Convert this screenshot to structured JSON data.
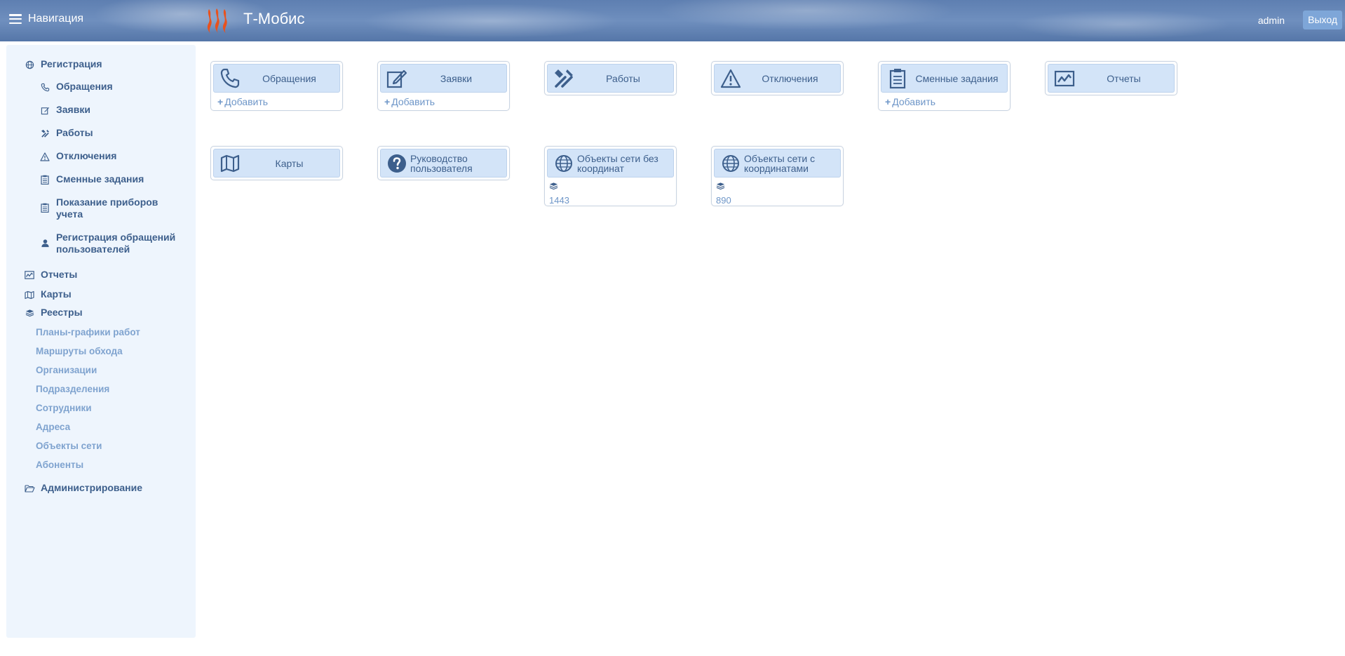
{
  "header": {
    "nav_label": "Навигация",
    "app_title": "Т-Мобис",
    "user": "admin",
    "logout": "Выход"
  },
  "sidebar": {
    "registration": "Регистрация",
    "reg_items": [
      "Обращения",
      "Заявки",
      "Работы",
      "Отключения",
      "Сменные задания",
      "Показание приборов учета",
      "Регистрация обращений пользователей"
    ],
    "reports": "Отчеты",
    "maps": "Карты",
    "registries": "Реестры",
    "registry_items": [
      "Планы-графики работ",
      "Маршруты обхода",
      "Организации",
      "Подразделения",
      "Сотрудники",
      "Адреса",
      "Объекты сети",
      "Абоненты"
    ],
    "admin": "Администрирование"
  },
  "cards": {
    "appeals": "Обращения",
    "requests": "Заявки",
    "works": "Работы",
    "outages": "Отключения",
    "shift_tasks": "Сменные задания",
    "reports": "Отчеты",
    "maps": "Карты",
    "manual": "Руководство пользователя",
    "objects_no_coords": "Объекты сети без координат",
    "objects_no_coords_count": "1443",
    "objects_with_coords": "Объекты сети с координатами",
    "objects_with_coords_count": "890",
    "add_label": "Добавить"
  },
  "colors": {
    "accent": "#3d5f8c",
    "button_bg": "#d3e4f8",
    "sidebar_bg": "#eef5fd",
    "link_light": "#7fa3cf",
    "logo": "#e8521e"
  }
}
